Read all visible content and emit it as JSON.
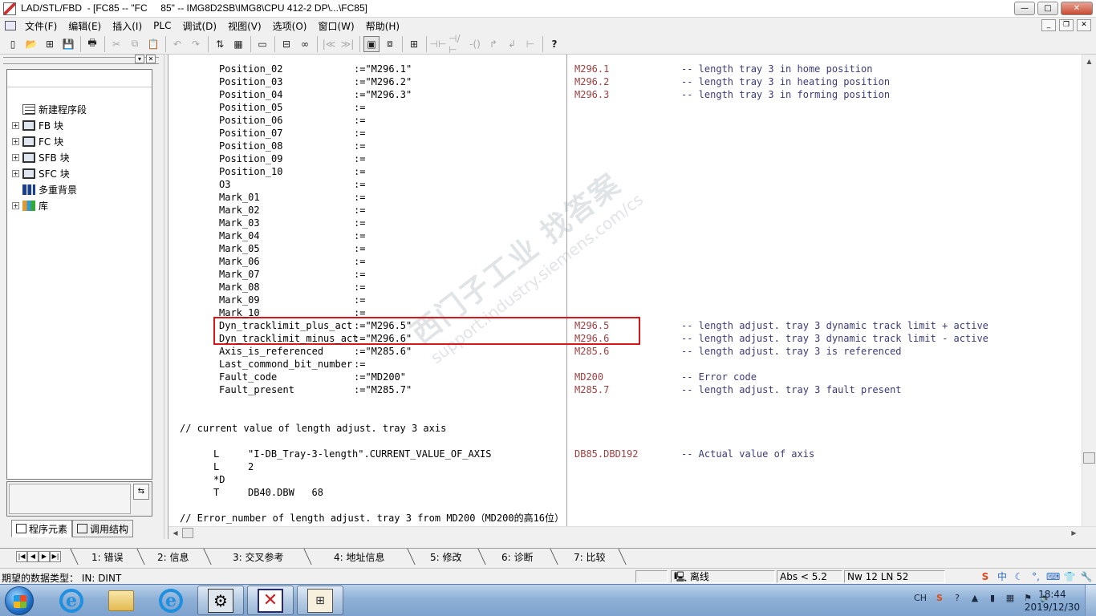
{
  "window": {
    "title": "LAD/STL/FBD  - [FC85 -- \"FC     85\" -- IMG8D2SB\\IMG8\\CPU 412-2 DP\\...\\FC85]",
    "min": "—",
    "max": "□",
    "close": "✕"
  },
  "menu": [
    "文件(F)",
    "编辑(E)",
    "插入(I)",
    "PLC",
    "调试(D)",
    "视图(V)",
    "选项(O)",
    "窗口(W)",
    "帮助(H)"
  ],
  "toolbar": {
    "icons": [
      "new-icon",
      "open-icon",
      "network-icon",
      "save-icon",
      "print-icon",
      "cut-icon",
      "copy-icon",
      "paste-icon",
      "undo-icon",
      "redo-icon",
      "load-icon",
      "monitor-icon",
      "view-icon",
      "compile-icon",
      "glasses-icon",
      "bookmark-prev-icon",
      "bookmark-next-icon",
      "overview-icon",
      "zoom-icon",
      "network-insert-icon",
      "contact-no-icon",
      "contact-nc-icon",
      "coil-icon",
      "branch-open-icon",
      "branch-close-icon",
      "connection-icon",
      "help-icon"
    ],
    "glyphs": [
      "▯",
      "📂",
      "⊞",
      "💾",
      "🖶",
      "✂",
      "⧉",
      "📋",
      "↶",
      "↷",
      "⇅",
      "▦",
      "▭",
      "⊟",
      "∞",
      "|≪",
      "≫|",
      "▣",
      "⧈",
      "⊞",
      "⊣⊢",
      "⊣/⊢",
      "-()",
      "↱",
      "↲",
      "⊢",
      "?"
    ]
  },
  "left_pane": {
    "tree": [
      {
        "label": "新建程序段",
        "icon": "new-network-icon",
        "expand": false
      },
      {
        "label": "FB 块",
        "icon": "block-icon",
        "expand": true
      },
      {
        "label": "FC 块",
        "icon": "block-icon",
        "expand": true
      },
      {
        "label": "SFB 块",
        "icon": "block-icon",
        "expand": true
      },
      {
        "label": "SFC 块",
        "icon": "block-icon",
        "expand": true
      },
      {
        "label": "多重背景",
        "icon": "multi-instance-icon",
        "expand": false
      },
      {
        "label": "库",
        "icon": "library-icon",
        "expand": true
      }
    ],
    "tabs": [
      "程序元素",
      "调用结构"
    ],
    "bottom_button": "⇆"
  },
  "code": {
    "params": [
      {
        "name": "Position_02",
        "assign": ":=\"M296.1\"",
        "addr": "M296.1",
        "comment": "-- length tray 3 in home position"
      },
      {
        "name": "Position_03",
        "assign": ":=\"M296.2\"",
        "addr": "M296.2",
        "comment": "-- length tray 3 in heating position"
      },
      {
        "name": "Position_04",
        "assign": ":=\"M296.3\"",
        "addr": "M296.3",
        "comment": "-- length tray 3 in forming position"
      },
      {
        "name": "Position_05",
        "assign": ":=",
        "addr": "",
        "comment": ""
      },
      {
        "name": "Position_06",
        "assign": ":=",
        "addr": "",
        "comment": ""
      },
      {
        "name": "Position_07",
        "assign": ":=",
        "addr": "",
        "comment": ""
      },
      {
        "name": "Position_08",
        "assign": ":=",
        "addr": "",
        "comment": ""
      },
      {
        "name": "Position_09",
        "assign": ":=",
        "addr": "",
        "comment": ""
      },
      {
        "name": "Position_10",
        "assign": ":=",
        "addr": "",
        "comment": ""
      },
      {
        "name": "O3",
        "assign": ":=",
        "addr": "",
        "comment": ""
      },
      {
        "name": "Mark_01",
        "assign": ":=",
        "addr": "",
        "comment": ""
      },
      {
        "name": "Mark_02",
        "assign": ":=",
        "addr": "",
        "comment": ""
      },
      {
        "name": "Mark_03",
        "assign": ":=",
        "addr": "",
        "comment": ""
      },
      {
        "name": "Mark_04",
        "assign": ":=",
        "addr": "",
        "comment": ""
      },
      {
        "name": "Mark_05",
        "assign": ":=",
        "addr": "",
        "comment": ""
      },
      {
        "name": "Mark_06",
        "assign": ":=",
        "addr": "",
        "comment": ""
      },
      {
        "name": "Mark_07",
        "assign": ":=",
        "addr": "",
        "comment": ""
      },
      {
        "name": "Mark_08",
        "assign": ":=",
        "addr": "",
        "comment": ""
      },
      {
        "name": "Mark_09",
        "assign": ":=",
        "addr": "",
        "comment": ""
      },
      {
        "name": "Mark_10",
        "assign": ":=",
        "addr": "",
        "comment": ""
      },
      {
        "name": "Dyn_tracklimit_plus_act",
        "assign": ":=\"M296.5\"",
        "addr": "M296.5",
        "comment": "-- length adjust. tray 3 dynamic track limit + active"
      },
      {
        "name": "Dyn_tracklimit_minus_act",
        "assign": ":=\"M296.6\"",
        "addr": "M296.6",
        "comment": "-- length adjust. tray 3 dynamic track limit - active"
      },
      {
        "name": "Axis_is_referenced",
        "assign": ":=\"M285.6\"",
        "addr": "M285.6",
        "comment": "-- length adjust. tray 3 is referenced"
      },
      {
        "name": "Last_commond_bit_number",
        "assign": ":=",
        "addr": "",
        "comment": ""
      },
      {
        "name": "Fault_code",
        "assign": ":=\"MD200\"",
        "addr": "MD200",
        "comment": "-- Error code"
      },
      {
        "name": "Fault_present",
        "assign": ":=\"M285.7\"",
        "addr": "M285.7",
        "comment": "-- length adjust. tray 3 fault present"
      }
    ],
    "comment1": "// current value of length adjust. tray 3 axis",
    "instr": [
      {
        "op": "L",
        "operand": "\"I-DB_Tray-3-length\".CURRENT_VALUE_OF_AXIS",
        "addr": "DB85.DBD192",
        "comment": "-- Actual value of axis"
      },
      {
        "op": "L",
        "operand": "2",
        "addr": "",
        "comment": ""
      },
      {
        "op": "*D",
        "operand": "",
        "addr": "",
        "comment": ""
      },
      {
        "op": "T",
        "operand": "DB40.DBW   68",
        "addr": "",
        "comment": ""
      }
    ],
    "comment2": "// Error_number of length adjust. tray 3 from MD200（MD200的高16位）"
  },
  "watermark": {
    "line1": "西门子工业 找答案",
    "line2": "support.industry.siemens.com/cs"
  },
  "bottom_tabs": [
    "1: 错误",
    "2: 信息",
    "3: 交叉参考",
    "4: 地址信息",
    "5: 修改",
    "6: 诊断",
    "7: 比较"
  ],
  "status": {
    "message": "期望的数据类型： IN: DINT",
    "mode": "离线",
    "abs": "Abs < 5.2",
    "position": "Nw 12  LN 52"
  },
  "ime_icons": [
    "S",
    "中",
    "☾",
    "°,",
    "⌨",
    "👕",
    "🔧"
  ],
  "taskbar": {
    "apps": [
      "ie-icon",
      "explorer-icon",
      "ie-icon",
      "step7-icon",
      "simatic-manager-icon",
      "lad-stl-fbd-icon"
    ],
    "tray_lang": "CH",
    "time": "18:44",
    "date": "2019/12/30"
  }
}
